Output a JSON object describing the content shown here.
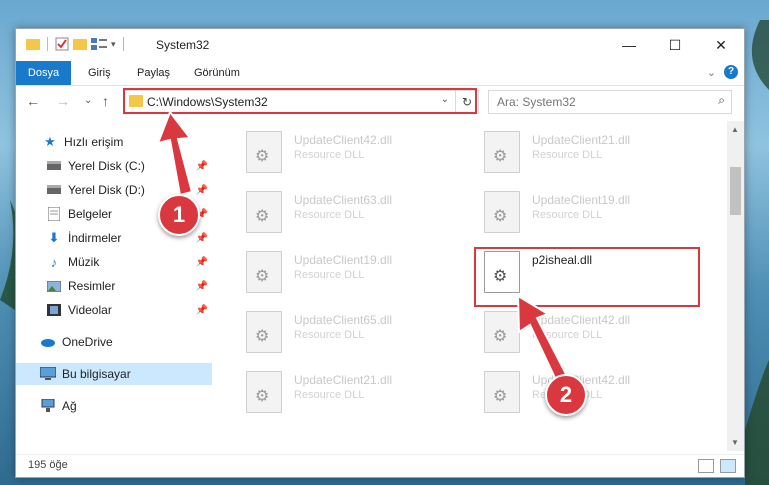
{
  "window": {
    "title": "System32",
    "controls": {
      "minimize": "—",
      "maximize": "☐",
      "close": "✕"
    }
  },
  "ribbon": {
    "tabs": [
      "Dosya",
      "Giriş",
      "Paylaş",
      "Görünüm"
    ],
    "help": "?",
    "expand": "⌄"
  },
  "nav": {
    "back": "←",
    "forward": "→",
    "recent": "⌄",
    "up": "↑",
    "address": "C:\\Windows\\System32",
    "address_drop": "⌄",
    "refresh": "↻",
    "search_placeholder": "Ara: System32"
  },
  "sidebar": {
    "quick_access": "Hızlı erişim",
    "items": [
      {
        "label": "Yerel Disk (C:)",
        "icon": "drive-icon"
      },
      {
        "label": "Yerel Disk (D:)",
        "icon": "drive-icon"
      },
      {
        "label": "Belgeler",
        "icon": "documents-icon"
      },
      {
        "label": "İndirmeler",
        "icon": "download-icon"
      },
      {
        "label": "Müzik",
        "icon": "music-icon"
      },
      {
        "label": "Resimler",
        "icon": "pictures-icon"
      },
      {
        "label": "Videolar",
        "icon": "video-icon"
      }
    ],
    "onedrive": "OneDrive",
    "this_pc": "Bu bilgisayar",
    "network": "Ağ"
  },
  "files": {
    "left_column": [
      {
        "name": "UpdateClient42.dll",
        "type": "Resource DLL"
      },
      {
        "name": "UpdateClient63.dll",
        "type": "Resource DLL"
      },
      {
        "name": "UpdateClient19.dll",
        "type": "Resource DLL"
      },
      {
        "name": "UpdateClient65.dll",
        "type": "Resource DLL"
      },
      {
        "name": "UpdateClient21.dll",
        "type": "Resource DLL"
      }
    ],
    "right_column": [
      {
        "name": "UpdateClient21.dll",
        "type": "Resource DLL"
      },
      {
        "name": "UpdateClient19.dll",
        "type": "Resource DLL"
      },
      {
        "name": "p2isheal.dll",
        "type": ""
      },
      {
        "name": "UpdateClient42.dll",
        "type": "Resource DLL"
      },
      {
        "name": "UpdateClient42.dll",
        "type": "Resource DLL"
      }
    ]
  },
  "status": {
    "count": "195 öğe"
  },
  "annotations": {
    "step1": "1",
    "step2": "2",
    "color": "#d9383f"
  }
}
